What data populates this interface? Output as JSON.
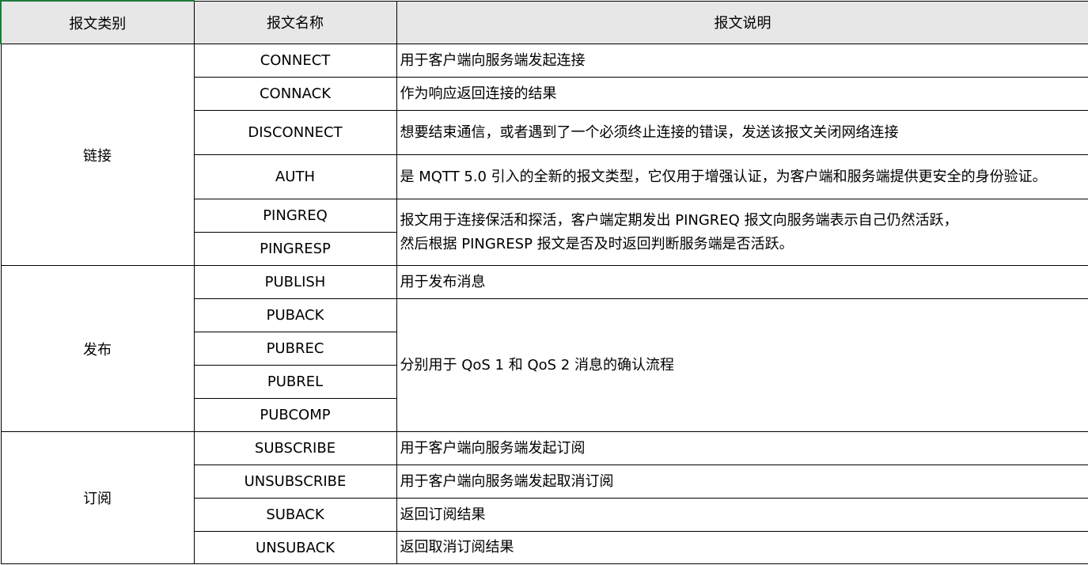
{
  "headers": {
    "category": "报文类别",
    "name": "报文名称",
    "description": "报文说明"
  },
  "groups": {
    "connect": "链接",
    "publish": "发布",
    "subscribe": "订阅"
  },
  "rows": {
    "connect_name": "CONNECT",
    "connect_desc": "用于客户端向服务端发起连接",
    "connack_name": "CONNACK",
    "connack_desc": "作为响应返回连接的结果",
    "disconnect_name": "DISCONNECT",
    "disconnect_desc": "想要结束通信，或者遇到了一个必须终止连接的错误，发送该报文关闭网络连接",
    "auth_name": "AUTH",
    "auth_desc": "是 MQTT 5.0 引入的全新的报文类型，它仅用于增强认证，为客户端和服务端提供更安全的身份验证。",
    "pingreq_name": "PINGREQ",
    "pingresp_name": "PINGRESP",
    "ping_desc_line1": "报文用于连接保活和探活，客户端定期发出 PINGREQ 报文向服务端表示自己仍然活跃，",
    "ping_desc_line2": "然后根据 PINGRESP 报文是否及时返回判断服务端是否活跃。",
    "publish_name": "PUBLISH",
    "publish_desc": "用于发布消息",
    "puback_name": "PUBACK",
    "pubrec_name": "PUBREC",
    "pubrel_name": "PUBREL",
    "pubcomp_name": "PUBCOMP",
    "qos_desc": "分别用于 QoS 1 和 QoS 2 消息的确认流程",
    "subscribe_name": "SUBSCRIBE",
    "subscribe_desc": "用于客户端向服务端发起订阅",
    "unsubscribe_name": "UNSUBSCRIBE",
    "unsubscribe_desc": "用于客户端向服务端发起取消订阅",
    "suback_name": "SUBACK",
    "suback_desc": "返回订阅结果",
    "unsuback_name": "UNSUBACK",
    "unsuback_desc": "返回取消订阅结果"
  }
}
